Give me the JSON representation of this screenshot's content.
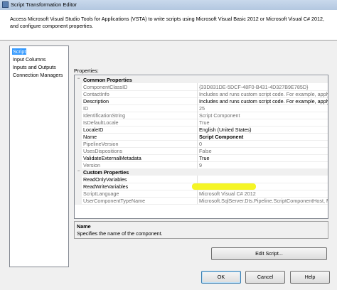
{
  "window": {
    "title": "Script Transformation Editor"
  },
  "description": "Access Microsoft Visual Studio Tools for Applications (VSTA) to write scripts using Microsoft Visual Basic 2012 or Microsoft Visual C# 2012, and configure component properties.",
  "nav": {
    "items": [
      {
        "label": "Script",
        "selected": true
      },
      {
        "label": "Input Columns",
        "selected": false
      },
      {
        "label": "Inputs and Outputs",
        "selected": false
      },
      {
        "label": "Connection Managers",
        "selected": false
      }
    ]
  },
  "properties": {
    "label": "Properties:",
    "categories": [
      {
        "name": "Common Properties",
        "toggle": "−",
        "rows": [
          {
            "name": "ComponentClassID",
            "value": "{33D831DE-5DCF-48F0-B431-4D327B9E785D}",
            "disabled": true,
            "bold": false
          },
          {
            "name": "ContactInfo",
            "value": "Includes and runs custom script code. For example, apply a b",
            "disabled": true,
            "bold": false
          },
          {
            "name": "Description",
            "value": "Includes and runs custom script code. For example, apply a b",
            "disabled": false,
            "bold": false
          },
          {
            "name": "ID",
            "value": "25",
            "disabled": true,
            "bold": false
          },
          {
            "name": "IdentificationString",
            "value": "Script Component",
            "disabled": true,
            "bold": false
          },
          {
            "name": "IsDefaultLocale",
            "value": "True",
            "disabled": true,
            "bold": false
          },
          {
            "name": "LocaleID",
            "value": "English (United States)",
            "disabled": false,
            "bold": false
          },
          {
            "name": "Name",
            "value": "Script Component",
            "disabled": false,
            "bold": true
          },
          {
            "name": "PipelineVersion",
            "value": "0",
            "disabled": true,
            "bold": false
          },
          {
            "name": "UsesDispositions",
            "value": "False",
            "disabled": true,
            "bold": false
          },
          {
            "name": "ValidateExternalMetadata",
            "value": "True",
            "disabled": false,
            "bold": false
          },
          {
            "name": "Version",
            "value": "9",
            "disabled": true,
            "bold": false
          }
        ]
      },
      {
        "name": "Custom Properties",
        "toggle": "−",
        "rows": [
          {
            "name": "ReadOnlyVariables",
            "value": "",
            "disabled": false,
            "bold": false
          },
          {
            "name": "ReadWriteVariables",
            "value": "",
            "disabled": false,
            "bold": false
          },
          {
            "name": "ScriptLanguage",
            "value": "Microsoft Visual C# 2012",
            "disabled": true,
            "bold": false
          },
          {
            "name": "UserComponentTypeName",
            "value": "Microsoft.SqlServer.Dts.Pipeline.ScriptComponentHost, Micr",
            "disabled": true,
            "bold": false
          }
        ]
      }
    ]
  },
  "help": {
    "title": "Name",
    "text": "Specifies the name of the component."
  },
  "buttons": {
    "edit_script": "Edit Script...",
    "ok": "OK",
    "cancel": "Cancel",
    "help": "Help"
  },
  "colors": {
    "selection": "#3399ff",
    "highlighter": "#f4f41a"
  }
}
